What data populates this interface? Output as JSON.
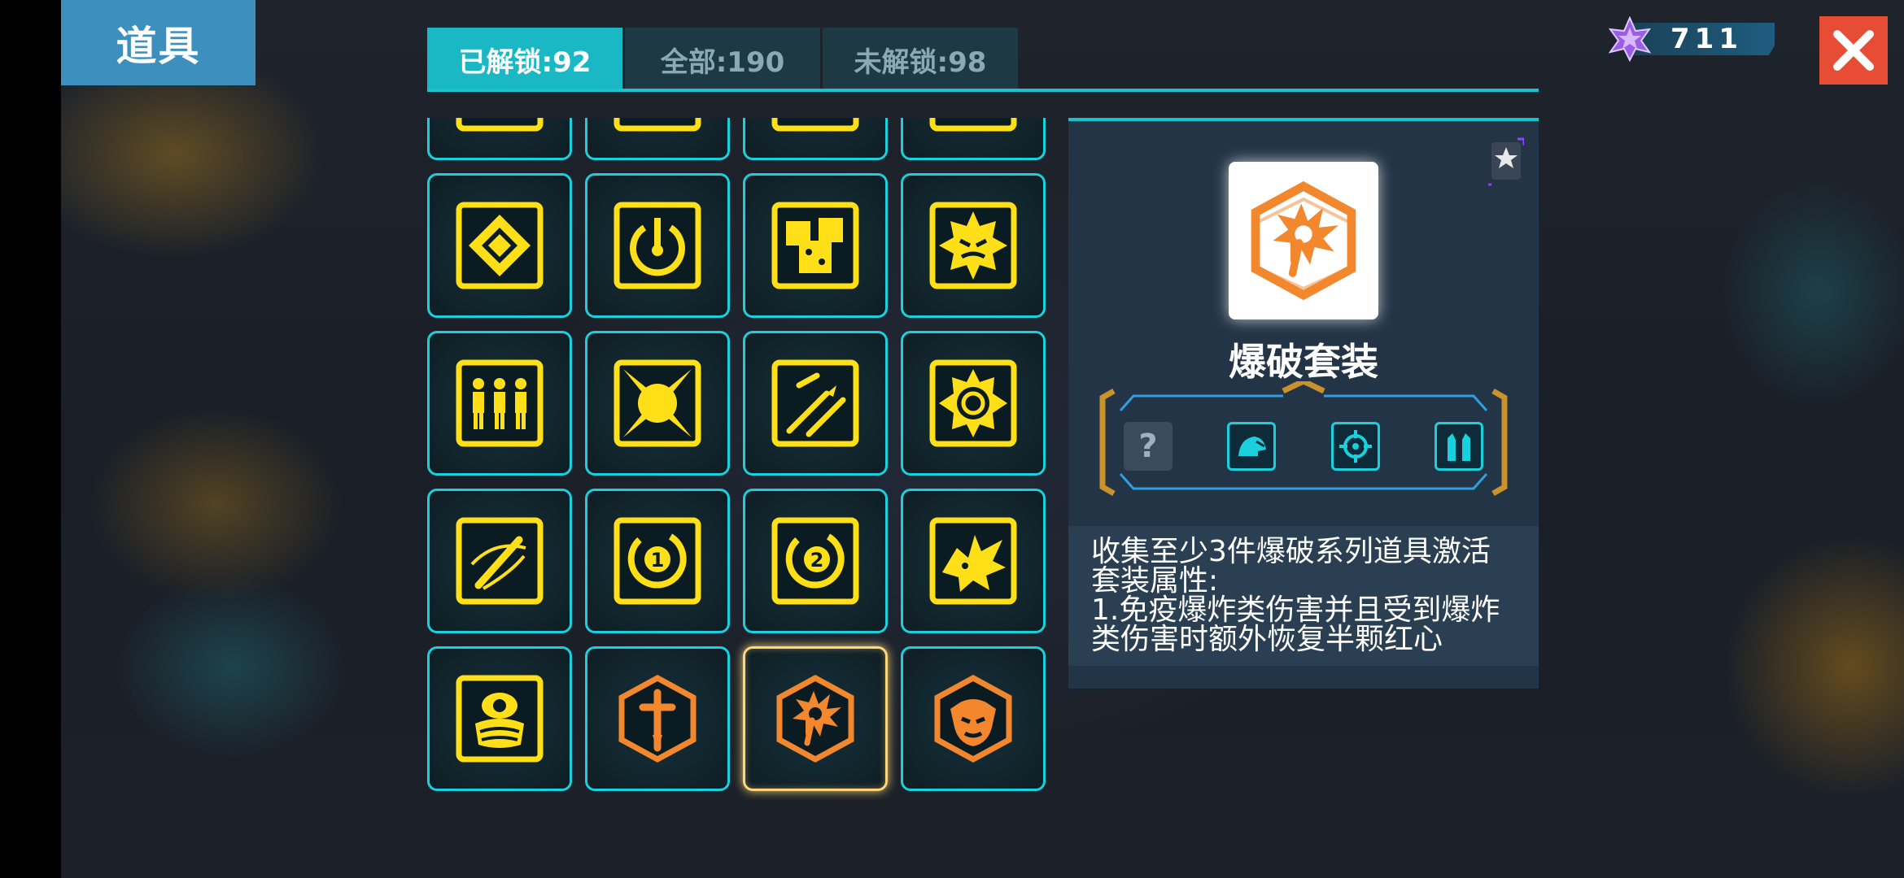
{
  "header": {
    "title": "道具"
  },
  "tabs": [
    {
      "label": "已解锁:92",
      "active": true
    },
    {
      "label": "全部:190",
      "active": false
    },
    {
      "label": "未解锁:98",
      "active": false
    }
  ],
  "currency": {
    "value": "711",
    "icon": "purple-star-icon"
  },
  "close": {
    "icon": "close-icon"
  },
  "items": [
    {
      "icon": "split-box-icon",
      "tier": "yellow"
    },
    {
      "icon": "target-ring-icon",
      "tier": "yellow"
    },
    {
      "icon": "tray-icon",
      "tier": "yellow"
    },
    {
      "icon": "branch-icon",
      "tier": "yellow"
    },
    {
      "icon": "diamond-icon",
      "tier": "yellow"
    },
    {
      "icon": "power-ring-icon",
      "tier": "yellow"
    },
    {
      "icon": "dice-icon",
      "tier": "yellow"
    },
    {
      "icon": "angry-sun-icon",
      "tier": "yellow"
    },
    {
      "icon": "three-people-icon",
      "tier": "yellow"
    },
    {
      "icon": "star-orb-icon",
      "tier": "yellow"
    },
    {
      "icon": "missiles-icon",
      "tier": "yellow"
    },
    {
      "icon": "spiky-ring-icon",
      "tier": "yellow"
    },
    {
      "icon": "slash-icon",
      "tier": "yellow"
    },
    {
      "icon": "cycle-one-icon",
      "tier": "yellow",
      "label": "1"
    },
    {
      "icon": "cycle-two-icon",
      "tier": "yellow",
      "label": "2"
    },
    {
      "icon": "dragon-icon",
      "tier": "yellow"
    },
    {
      "icon": "diver-icon",
      "tier": "yellow"
    },
    {
      "icon": "sword-hex-icon",
      "tier": "orange"
    },
    {
      "icon": "blast-hex-icon",
      "tier": "orange",
      "selected": true
    },
    {
      "icon": "demon-hex-icon",
      "tier": "orange"
    }
  ],
  "detail": {
    "name": "爆破套装",
    "set_unknown": "?",
    "set_icons": [
      "question-icon",
      "helmet-icon",
      "crosshair-icon",
      "vest-icon"
    ],
    "description": [
      "收集至少3件爆破系列道具激活",
      "套装属性:",
      "1.免疫爆炸类伤害并且受到爆炸",
      "类伤害时额外恢复半颗红心"
    ]
  },
  "colors": {
    "accent": "#1ac2cf",
    "icon_yellow": "#ffe018",
    "icon_orange": "#f2872e",
    "close": "#e74c35",
    "title_bg": "#3d8fbd"
  }
}
